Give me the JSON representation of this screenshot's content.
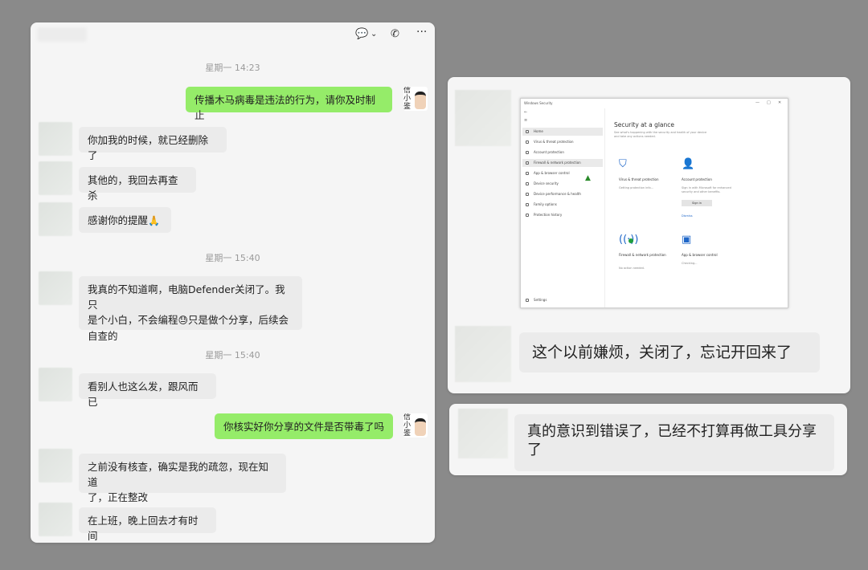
{
  "chat": {
    "header_icons": [
      "chat-bubble-icon",
      "chevron-down-icon",
      "phone-icon",
      "more-icon"
    ],
    "messages": [
      {
        "kind": "time",
        "text": "星期一 14:23"
      },
      {
        "kind": "sent",
        "text": "传播木马病毒是违法的行为，请你及时制止",
        "avatar_label": "信小鉴"
      },
      {
        "kind": "recv",
        "text": "你加我的时候，就已经删除了"
      },
      {
        "kind": "recv",
        "text": "其他的，我回去再查杀"
      },
      {
        "kind": "recv",
        "text": "感谢你的提醒",
        "emoji": "🙏"
      },
      {
        "kind": "time",
        "text": "星期一 15:40"
      },
      {
        "kind": "recv",
        "text_parts": [
          "我真的不知道啊，电脑Defender关闭了。我只",
          "是个小白，不会编程",
          "只是做个分享，后续会",
          "自查的"
        ],
        "emoji": "😓"
      },
      {
        "kind": "time",
        "text": "星期一 15:40"
      },
      {
        "kind": "recv",
        "text": "看别人也这么发，跟风而已"
      },
      {
        "kind": "sent",
        "text": "你核实好你分享的文件是否带毒了吗",
        "avatar_label": "信小鉴"
      },
      {
        "kind": "recv",
        "text_parts": [
          "之前没有核查，确实是我的疏忽，现在知道",
          "了，正在整改"
        ]
      },
      {
        "kind": "recv",
        "text": "在上班，晚上回去才有时间"
      }
    ]
  },
  "screenshot": {
    "window_title": "Windows Security",
    "controls": [
      "—",
      "□",
      "✕"
    ],
    "back": "←",
    "menu": "≡",
    "nav": [
      "Home",
      "Virus & threat protection",
      "Account protection",
      "Firewall & network protection",
      "App & browser control",
      "Device security",
      "Device performance & health",
      "Family options",
      "Protection history"
    ],
    "selected_nav_index": 3,
    "settings": "Settings",
    "heading": "Security at a glance",
    "subheading": "See what's happening with the security and health of your device and take any actions needed.",
    "tiles": [
      {
        "icon": "shield-icon",
        "title": "Virus & threat protection",
        "desc": "Getting protection info..."
      },
      {
        "icon": "person-icon",
        "title": "Account protection",
        "desc": "Sign in with Microsoft for enhanced security and other benefits.",
        "button": "Sign in",
        "link": "Dismiss"
      },
      {
        "icon": "wifi-icon",
        "title": "Firewall & network protection",
        "desc": "No action needed."
      },
      {
        "icon": "window-icon",
        "title": "App & browser control",
        "desc": "Checking..."
      }
    ],
    "accent": "#1e66c8"
  },
  "panel2": {
    "message": "这个以前嫌烦，关闭了，忘记开回来了"
  },
  "panel3": {
    "message_lines": [
      "真的意识到错误了，已经不打算再做工具分享",
      "了"
    ]
  }
}
